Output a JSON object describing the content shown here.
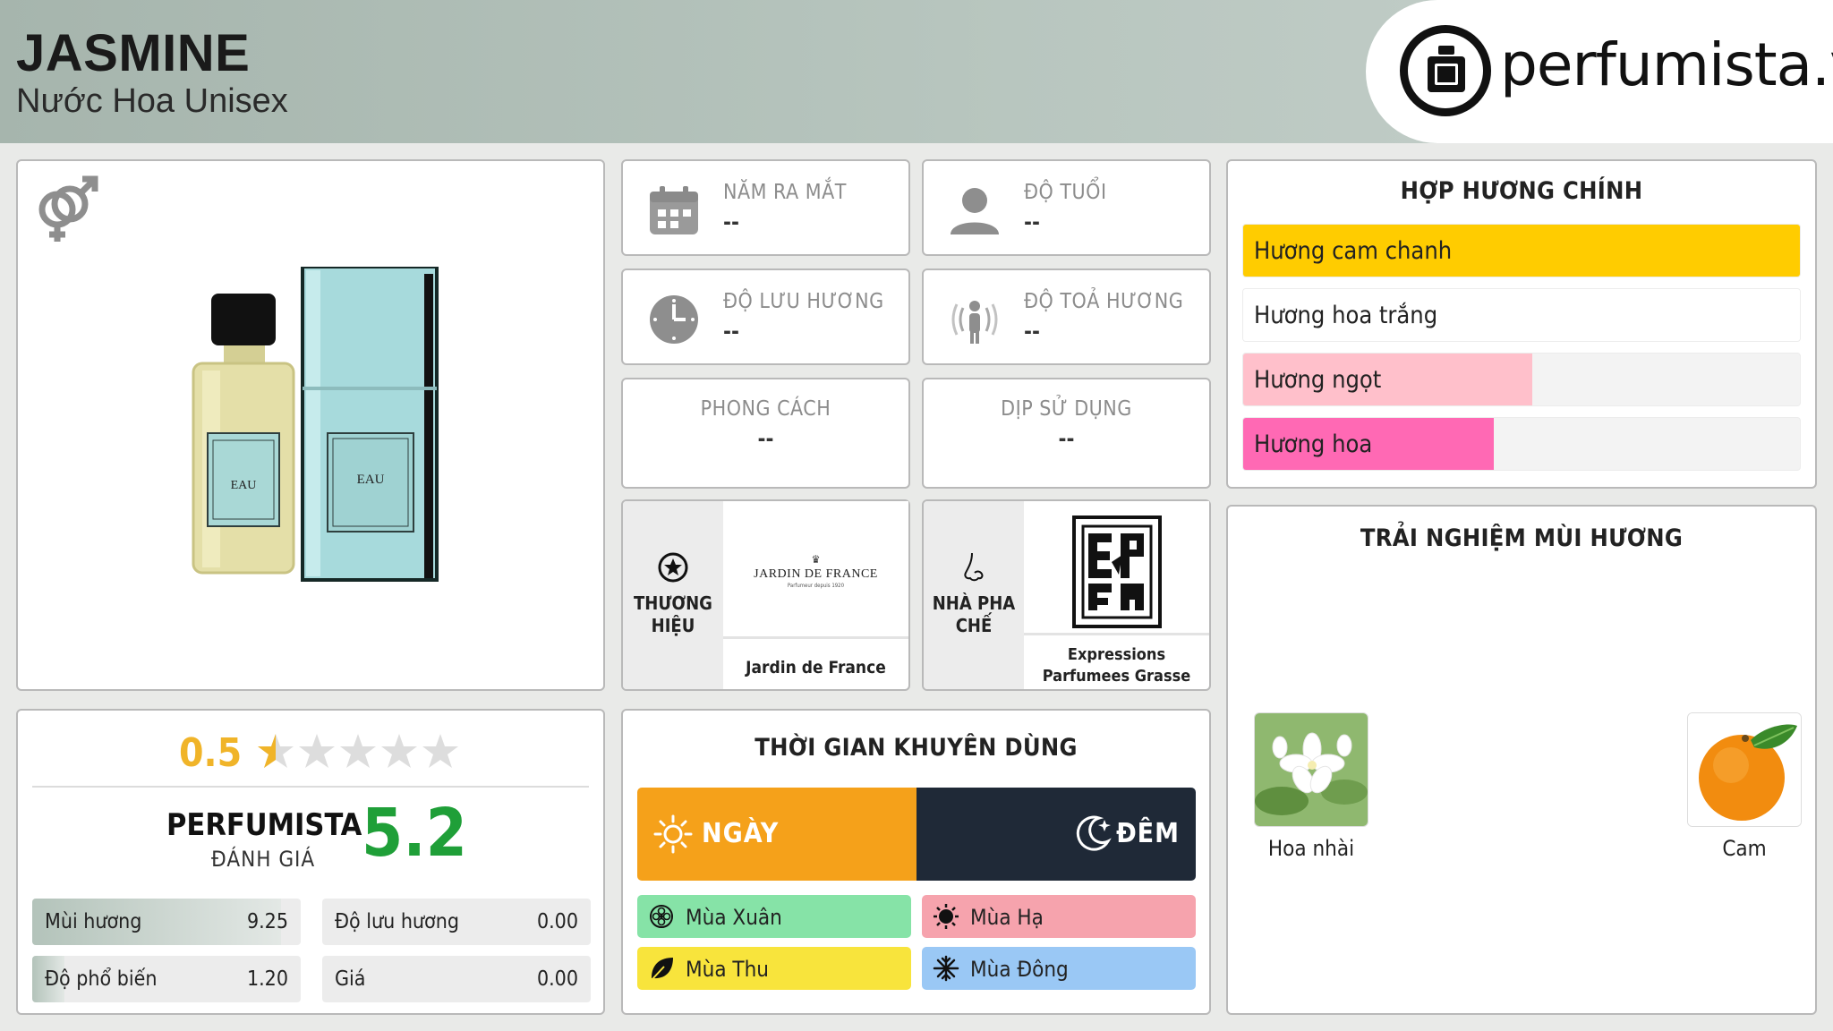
{
  "header": {
    "title": "JASMINE",
    "subtitle": "Nước Hoa Unisex",
    "logo_text": "perfumista.vn"
  },
  "product_image": {
    "bottle_label": "EAU",
    "box_label": "EAU"
  },
  "info": {
    "launch_year": {
      "label": "NĂM RA MẮT",
      "value": "--",
      "icon": "calendar-icon"
    },
    "age": {
      "label": "ĐỘ TUỔI",
      "value": "--",
      "icon": "user-icon"
    },
    "longevity": {
      "label": "ĐỘ LƯU HƯƠNG",
      "value": "--",
      "icon": "clock-icon"
    },
    "sillage": {
      "label": "ĐỘ TOẢ HƯƠNG",
      "value": "--",
      "icon": "sillage-icon"
    },
    "style": {
      "label": "PHONG CÁCH",
      "value": "--"
    },
    "occasion": {
      "label": "DỊP SỬ DỤNG",
      "value": "--"
    }
  },
  "brand": {
    "label": "THƯƠNG HIỆU",
    "logo_text": "JARDIN DE FRANCE",
    "logo_sub": "Parfumeur depuis 1920",
    "name": "Jardin de France"
  },
  "perfumer": {
    "label": "NHÀ PHA CHẾ",
    "name": "Expressions Parfumees Grasse"
  },
  "accords": {
    "title": "HỢP HƯƠNG CHÍNH",
    "items": [
      {
        "label": "Hương cam chanh",
        "fill": 1.0,
        "color": "#ffcc00"
      },
      {
        "label": "Hương hoa trắng",
        "fill": 1.0,
        "color": "#ffffff"
      },
      {
        "label": "Hương ngọt",
        "fill": 0.52,
        "color": "#ffc0cb"
      },
      {
        "label": "Hương hoa",
        "fill": 0.45,
        "color": "#ff69b4"
      }
    ]
  },
  "experience": {
    "title": "TRẢI NGHIỆM MÙI HƯƠNG",
    "items": [
      {
        "label": "Hoa nhài",
        "icon": "jasmine-flower-image"
      },
      {
        "label": "Cam",
        "icon": "orange-fruit-image"
      }
    ]
  },
  "rating": {
    "value": "0.5",
    "stars_filled": 0.5,
    "stars_total": 5,
    "perfumista_label": "PERFUMISTA",
    "perfumista_sub": "ĐÁNH GIÁ",
    "perfumista_score": "5.2",
    "metrics": [
      {
        "key": "Mùi hương",
        "value": "9.25",
        "fill": 0.925
      },
      {
        "key": "Độ lưu hương",
        "value": "0.00",
        "fill": 0
      },
      {
        "key": "Độ phổ biến",
        "value": "1.20",
        "fill": 0.12
      },
      {
        "key": "Giá",
        "value": "0.00",
        "fill": 0
      }
    ]
  },
  "time": {
    "title": "THỜI GIAN KHUYÊN DÙNG",
    "day": "NGÀY",
    "night": "ĐÊM",
    "seasons": [
      {
        "label": "Mùa Xuân",
        "color": "#86e3a7",
        "icon": "flower-icon"
      },
      {
        "label": "Mùa Hạ",
        "color": "#f6a3ad",
        "icon": "sun-icon"
      },
      {
        "label": "Mùa Thu",
        "color": "#f8e43c",
        "icon": "leaf-icon"
      },
      {
        "label": "Mùa Đông",
        "color": "#9ac8f5",
        "icon": "snowflake-icon"
      }
    ]
  },
  "colors": {
    "green_score": "#1f9f38",
    "star_gold": "#f0b429",
    "day": "#f5a11a",
    "night": "#1f2937"
  }
}
